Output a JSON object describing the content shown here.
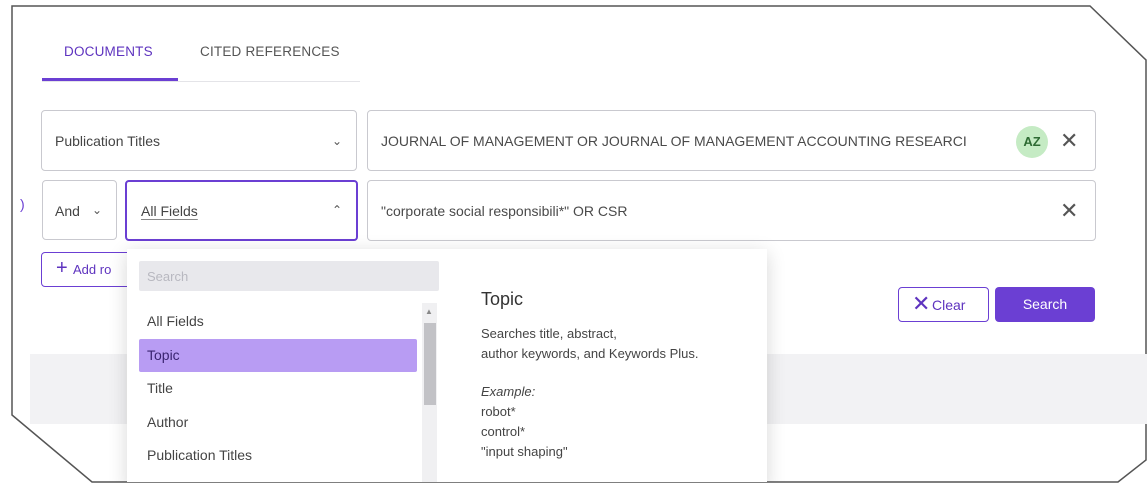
{
  "tabs": [
    {
      "label": "DOCUMENTS",
      "active": true
    },
    {
      "label": "CITED REFERENCES",
      "active": false
    }
  ],
  "row1": {
    "field_label": "Publication Titles",
    "query": "JOURNAL OF MANAGEMENT OR JOURNAL OF MANAGEMENT ACCOUNTING RESEARCI",
    "az_badge": "AZ"
  },
  "row2": {
    "boolean": "And",
    "field_label": "All Fields",
    "query": "\"corporate social responsibili*\" OR CSR"
  },
  "add_row_label": "Add ro",
  "clear_label": "Clear",
  "search_label": "Search",
  "dropdown": {
    "search_placeholder": "Search",
    "items": [
      {
        "label": "All Fields",
        "active": false
      },
      {
        "label": "Topic",
        "active": true
      },
      {
        "label": "Title",
        "active": false
      },
      {
        "label": "Author",
        "active": false
      },
      {
        "label": "Publication Titles",
        "active": false
      }
    ],
    "description": {
      "title": "Topic",
      "lines": [
        "Searches title, abstract,",
        "author keywords, and Keywords Plus."
      ],
      "example_label": "Example:",
      "examples": [
        "robot*",
        "control*",
        "\"input shaping\""
      ]
    }
  },
  "colors": {
    "accent": "#6b3fd3",
    "highlight": "#b89cf3",
    "badge": "#c5ebc4"
  }
}
